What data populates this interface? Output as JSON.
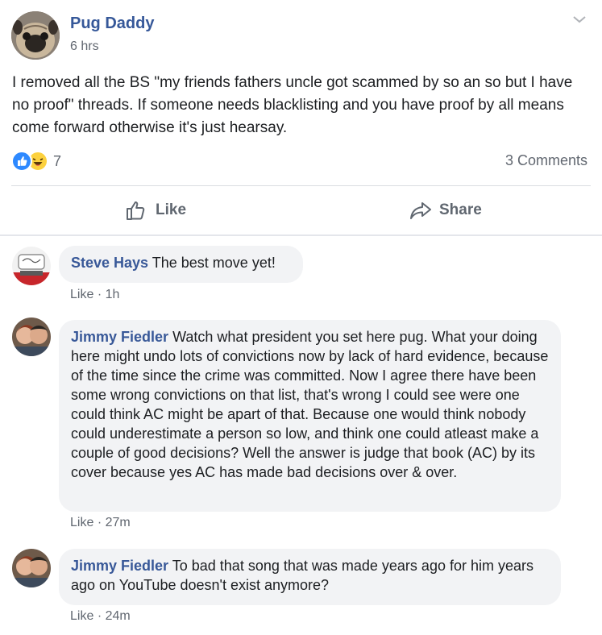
{
  "post": {
    "author": "Pug Daddy",
    "time": "6 hrs",
    "text": "I removed all the BS \"my friends fathers uncle got scammed by so an so but I have no proof\" threads. If someone needs blacklisting and you have proof by all means come forward otherwise it's just hearsay.",
    "reaction_count": "7",
    "comments_count": "3 Comments",
    "like_label": "Like",
    "share_label": "Share"
  },
  "comments": [
    {
      "name": "Steve Hays",
      "text": "The best move yet!",
      "like_label": "Like",
      "sep": "·",
      "time": "1h"
    },
    {
      "name": "Jimmy Fiedler",
      "text": "Watch what president you set here pug. What your doing here might undo lots of convictions now by lack of hard evidence, because of the time since the crime was committed. Now I agree there have been some wrong convictions on that list, that's wrong I could see were one could think AC might be apart of that. Because one would think nobody could underestimate a person so low, and think one could atleast make a couple of good decisions? Well the answer is judge that book (AC) by its cover because yes AC has made bad decisions over & over.",
      "like_label": "Like",
      "sep": "·",
      "time": "27m"
    },
    {
      "name": "Jimmy Fiedler",
      "text": "To bad that song that was made years ago for him years ago on YouTube doesn't exist anymore?",
      "like_label": "Like",
      "sep": "·",
      "time": "24m"
    }
  ],
  "colors": {
    "name_blue": "#365899",
    "meta_gray": "#616770",
    "bubble_bg": "#f2f3f5",
    "like_blue": "#2e89ff",
    "haha_yellow": "#fcd13e"
  },
  "icons": [
    "chevron-down-icon",
    "like-reaction-icon",
    "haha-reaction-icon",
    "thumbs-up-icon",
    "share-arrow-icon"
  ]
}
